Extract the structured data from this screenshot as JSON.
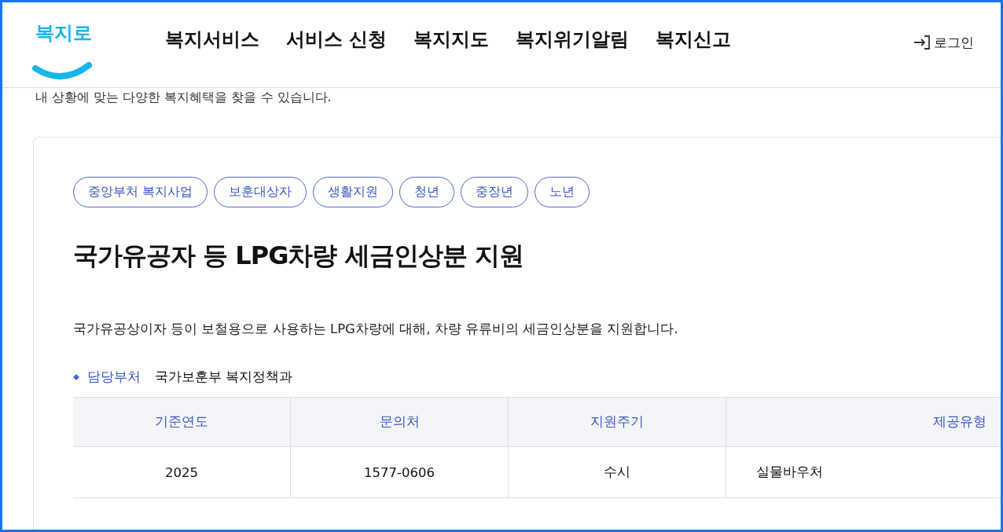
{
  "header": {
    "logo": "복지로",
    "nav": [
      "복지서비스",
      "서비스 신청",
      "복지지도",
      "복지위기알림",
      "복지신고"
    ],
    "login": "로그인"
  },
  "intro": "내 상황에 맞는 다양한 복지혜택을 찾을 수 있습니다.",
  "service": {
    "tags": [
      "중앙부처 복지사업",
      "보훈대상자",
      "생활지원",
      "청년",
      "중장년",
      "노년"
    ],
    "title": "국가유공자 등 LPG차량 세금인상분 지원",
    "description": "국가유공상이자 등이 보철용으로 사용하는 LPG차량에 대해, 차량 유류비의 세금인상분을 지원합니다.",
    "department": {
      "label": "담당부처",
      "value": "국가보훈부 복지정책과"
    },
    "table": {
      "columns": [
        "기준연도",
        "문의처",
        "지원주기",
        "제공유형"
      ],
      "rows": [
        [
          "2025",
          "1577-0606",
          "수시",
          "실물바우처"
        ]
      ]
    }
  }
}
